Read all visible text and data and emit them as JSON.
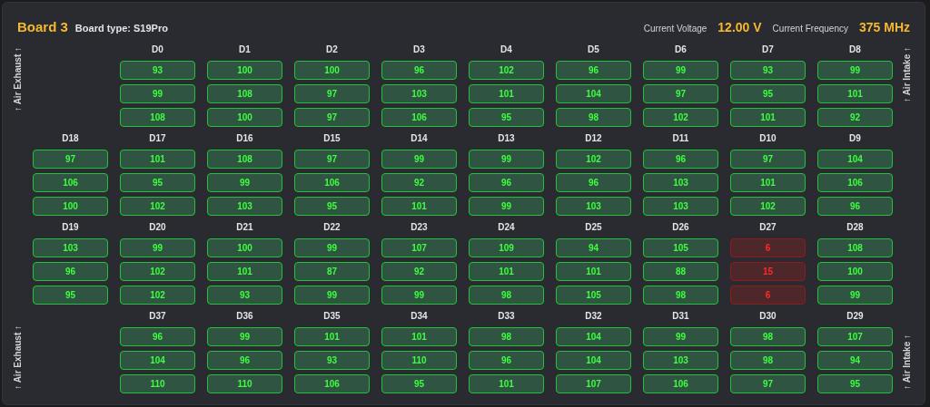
{
  "board": {
    "title": "Board 3",
    "type": "Board type: S19Pro"
  },
  "stats": [
    {
      "label": "Current Voltage",
      "value": "12.00 V"
    },
    {
      "label": "Current Frequency",
      "value": "375 MHz"
    }
  ],
  "airflow": {
    "left_top": "↑ Air Exhaust ↑",
    "left_bottom": "↑ Air Exhaust ↑",
    "right_top": "↑ Air Intake ↑",
    "right_bottom": "↑ Air Intake ↑"
  },
  "rows": [
    {
      "chips": [
        {
          "label": "D0",
          "alert": false,
          "readings": [
            "93",
            "99",
            "108"
          ]
        },
        {
          "label": "D1",
          "alert": false,
          "readings": [
            "100",
            "108",
            "100"
          ]
        },
        {
          "label": "D2",
          "alert": false,
          "readings": [
            "100",
            "97",
            "97"
          ]
        },
        {
          "label": "D3",
          "alert": false,
          "readings": [
            "96",
            "103",
            "106"
          ]
        },
        {
          "label": "D4",
          "alert": false,
          "readings": [
            "102",
            "101",
            "95"
          ]
        },
        {
          "label": "D5",
          "alert": false,
          "readings": [
            "96",
            "104",
            "98"
          ]
        },
        {
          "label": "D6",
          "alert": false,
          "readings": [
            "99",
            "97",
            "102"
          ]
        },
        {
          "label": "D7",
          "alert": false,
          "readings": [
            "93",
            "95",
            "101"
          ]
        },
        {
          "label": "D8",
          "alert": false,
          "readings": [
            "99",
            "101",
            "92"
          ]
        }
      ]
    },
    {
      "chips": [
        {
          "label": "D18",
          "alert": false,
          "readings": [
            "97",
            "106",
            "100"
          ]
        },
        {
          "label": "D17",
          "alert": false,
          "readings": [
            "101",
            "95",
            "102"
          ]
        },
        {
          "label": "D16",
          "alert": false,
          "readings": [
            "108",
            "99",
            "103"
          ]
        },
        {
          "label": "D15",
          "alert": false,
          "readings": [
            "97",
            "106",
            "95"
          ]
        },
        {
          "label": "D14",
          "alert": false,
          "readings": [
            "99",
            "92",
            "101"
          ]
        },
        {
          "label": "D13",
          "alert": false,
          "readings": [
            "99",
            "96",
            "99"
          ]
        },
        {
          "label": "D12",
          "alert": false,
          "readings": [
            "102",
            "96",
            "103"
          ]
        },
        {
          "label": "D11",
          "alert": false,
          "readings": [
            "96",
            "103",
            "103"
          ]
        },
        {
          "label": "D10",
          "alert": false,
          "readings": [
            "97",
            "101",
            "102"
          ]
        },
        {
          "label": "D9",
          "alert": false,
          "readings": [
            "104",
            "106",
            "96"
          ]
        }
      ]
    },
    {
      "chips": [
        {
          "label": "D19",
          "alert": false,
          "readings": [
            "103",
            "96",
            "95"
          ]
        },
        {
          "label": "D20",
          "alert": false,
          "readings": [
            "99",
            "102",
            "102"
          ]
        },
        {
          "label": "D21",
          "alert": false,
          "readings": [
            "100",
            "101",
            "93"
          ]
        },
        {
          "label": "D22",
          "alert": false,
          "readings": [
            "99",
            "87",
            "99"
          ]
        },
        {
          "label": "D23",
          "alert": false,
          "readings": [
            "107",
            "92",
            "99"
          ]
        },
        {
          "label": "D24",
          "alert": false,
          "readings": [
            "109",
            "101",
            "98"
          ]
        },
        {
          "label": "D25",
          "alert": false,
          "readings": [
            "94",
            "101",
            "105"
          ]
        },
        {
          "label": "D26",
          "alert": false,
          "readings": [
            "105",
            "88",
            "98"
          ]
        },
        {
          "label": "D27",
          "alert": true,
          "readings": [
            "6",
            "15",
            "6"
          ]
        },
        {
          "label": "D28",
          "alert": false,
          "readings": [
            "108",
            "100",
            "99"
          ]
        }
      ]
    },
    {
      "chips": [
        {
          "label": "D37",
          "alert": false,
          "readings": [
            "96",
            "104",
            "110"
          ]
        },
        {
          "label": "D36",
          "alert": false,
          "readings": [
            "99",
            "96",
            "110"
          ]
        },
        {
          "label": "D35",
          "alert": false,
          "readings": [
            "101",
            "93",
            "106"
          ]
        },
        {
          "label": "D34",
          "alert": false,
          "readings": [
            "101",
            "110",
            "95"
          ]
        },
        {
          "label": "D33",
          "alert": false,
          "readings": [
            "98",
            "96",
            "101"
          ]
        },
        {
          "label": "D32",
          "alert": false,
          "readings": [
            "104",
            "104",
            "107"
          ]
        },
        {
          "label": "D31",
          "alert": false,
          "readings": [
            "99",
            "103",
            "106"
          ]
        },
        {
          "label": "D30",
          "alert": false,
          "readings": [
            "98",
            "98",
            "97"
          ]
        },
        {
          "label": "D29",
          "alert": false,
          "readings": [
            "107",
            "94",
            "95"
          ]
        }
      ]
    }
  ]
}
